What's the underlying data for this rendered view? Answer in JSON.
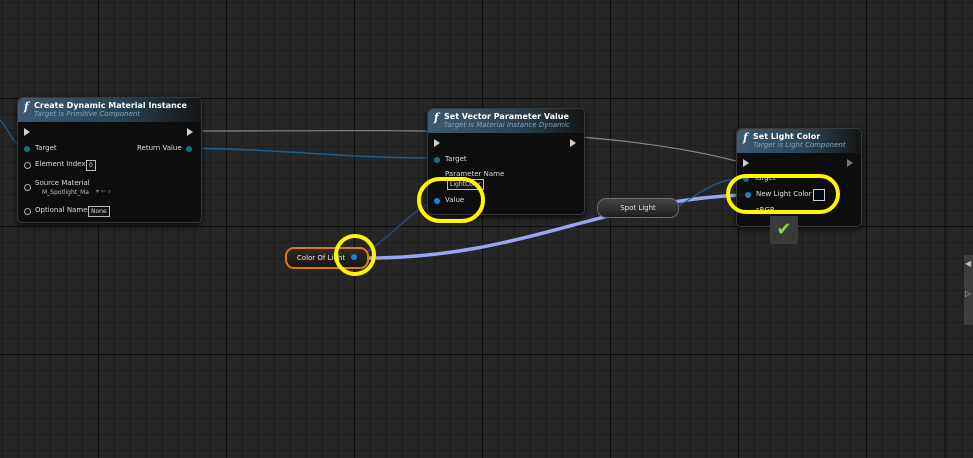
{
  "nodes": {
    "create_dmi": {
      "title": "Create Dynamic Material Instance",
      "subtitle": "Target is Primitive Component",
      "pins": {
        "target": "Target",
        "element_index": "Element Index",
        "element_index_value": "0",
        "source_material": "Source Material",
        "source_material_value": "M_Spotlight_Ma",
        "optional_name": "Optional Name",
        "optional_name_value": "None",
        "return_value": "Return Value"
      }
    },
    "set_vector": {
      "title": "Set Vector Parameter Value",
      "subtitle": "Target is Material Instance Dynamic",
      "pins": {
        "target": "Target",
        "parameter_name": "Parameter Name",
        "parameter_name_value": "LightColor",
        "value": "Value"
      }
    },
    "set_light_color": {
      "title": "Set Light Color",
      "subtitle": "Target is Light Component",
      "pins": {
        "target": "Target",
        "new_light_color": "New Light Color",
        "srgb": "sRGB"
      }
    }
  },
  "variables": {
    "color_of_light": "Color Of Light",
    "spot_light": "Spot Light"
  },
  "colors": {
    "highlight": "#fff700",
    "wire_color": "#9aa6f0",
    "exec_wire": "#8a8a8a",
    "object_wire": "#1e7fd6",
    "var_border": "#d97a16"
  },
  "icons": {
    "function": "f",
    "checkmark": "✔"
  }
}
